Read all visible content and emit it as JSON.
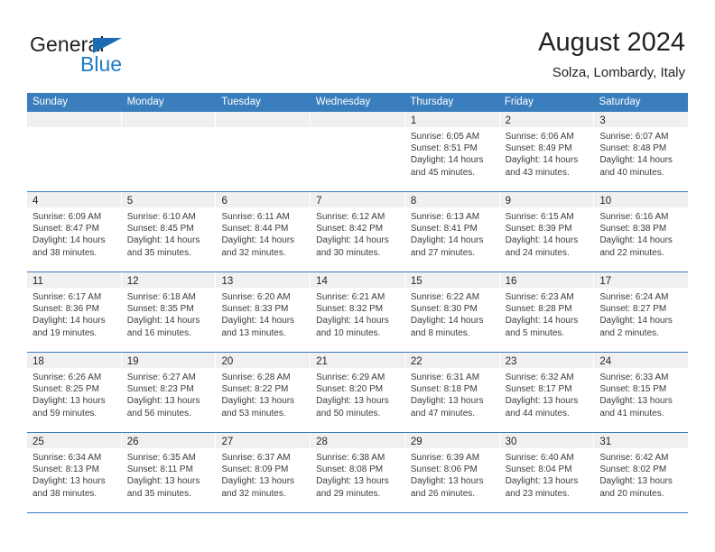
{
  "brand": {
    "word_one": "General",
    "word_two": "Blue",
    "flag_icon": "blue-triangle-flag-icon"
  },
  "header": {
    "title": "August 2024",
    "location": "Solza, Lombardy, Italy"
  },
  "colors": {
    "header_blue": "#3a7ebe",
    "brand_blue": "#1f7dc4",
    "day_band_gray": "#f0f0f0",
    "text": "#231f20"
  },
  "weekdays": [
    "Sunday",
    "Monday",
    "Tuesday",
    "Wednesday",
    "Thursday",
    "Friday",
    "Saturday"
  ],
  "labels": {
    "sunrise_prefix": "Sunrise:",
    "sunset_prefix": "Sunset:",
    "daylight_prefix": "Daylight:"
  },
  "weeks": [
    [
      {
        "day": "",
        "empty": true
      },
      {
        "day": "",
        "empty": true
      },
      {
        "day": "",
        "empty": true
      },
      {
        "day": "",
        "empty": true
      },
      {
        "day": "1",
        "sunrise": "Sunrise: 6:05 AM",
        "sunset": "Sunset: 8:51 PM",
        "daylight_line1": "Daylight: 14 hours",
        "daylight_line2": "and 45 minutes."
      },
      {
        "day": "2",
        "sunrise": "Sunrise: 6:06 AM",
        "sunset": "Sunset: 8:49 PM",
        "daylight_line1": "Daylight: 14 hours",
        "daylight_line2": "and 43 minutes."
      },
      {
        "day": "3",
        "sunrise": "Sunrise: 6:07 AM",
        "sunset": "Sunset: 8:48 PM",
        "daylight_line1": "Daylight: 14 hours",
        "daylight_line2": "and 40 minutes."
      }
    ],
    [
      {
        "day": "4",
        "sunrise": "Sunrise: 6:09 AM",
        "sunset": "Sunset: 8:47 PM",
        "daylight_line1": "Daylight: 14 hours",
        "daylight_line2": "and 38 minutes."
      },
      {
        "day": "5",
        "sunrise": "Sunrise: 6:10 AM",
        "sunset": "Sunset: 8:45 PM",
        "daylight_line1": "Daylight: 14 hours",
        "daylight_line2": "and 35 minutes."
      },
      {
        "day": "6",
        "sunrise": "Sunrise: 6:11 AM",
        "sunset": "Sunset: 8:44 PM",
        "daylight_line1": "Daylight: 14 hours",
        "daylight_line2": "and 32 minutes."
      },
      {
        "day": "7",
        "sunrise": "Sunrise: 6:12 AM",
        "sunset": "Sunset: 8:42 PM",
        "daylight_line1": "Daylight: 14 hours",
        "daylight_line2": "and 30 minutes."
      },
      {
        "day": "8",
        "sunrise": "Sunrise: 6:13 AM",
        "sunset": "Sunset: 8:41 PM",
        "daylight_line1": "Daylight: 14 hours",
        "daylight_line2": "and 27 minutes."
      },
      {
        "day": "9",
        "sunrise": "Sunrise: 6:15 AM",
        "sunset": "Sunset: 8:39 PM",
        "daylight_line1": "Daylight: 14 hours",
        "daylight_line2": "and 24 minutes."
      },
      {
        "day": "10",
        "sunrise": "Sunrise: 6:16 AM",
        "sunset": "Sunset: 8:38 PM",
        "daylight_line1": "Daylight: 14 hours",
        "daylight_line2": "and 22 minutes."
      }
    ],
    [
      {
        "day": "11",
        "sunrise": "Sunrise: 6:17 AM",
        "sunset": "Sunset: 8:36 PM",
        "daylight_line1": "Daylight: 14 hours",
        "daylight_line2": "and 19 minutes."
      },
      {
        "day": "12",
        "sunrise": "Sunrise: 6:18 AM",
        "sunset": "Sunset: 8:35 PM",
        "daylight_line1": "Daylight: 14 hours",
        "daylight_line2": "and 16 minutes."
      },
      {
        "day": "13",
        "sunrise": "Sunrise: 6:20 AM",
        "sunset": "Sunset: 8:33 PM",
        "daylight_line1": "Daylight: 14 hours",
        "daylight_line2": "and 13 minutes."
      },
      {
        "day": "14",
        "sunrise": "Sunrise: 6:21 AM",
        "sunset": "Sunset: 8:32 PM",
        "daylight_line1": "Daylight: 14 hours",
        "daylight_line2": "and 10 minutes."
      },
      {
        "day": "15",
        "sunrise": "Sunrise: 6:22 AM",
        "sunset": "Sunset: 8:30 PM",
        "daylight_line1": "Daylight: 14 hours",
        "daylight_line2": "and 8 minutes."
      },
      {
        "day": "16",
        "sunrise": "Sunrise: 6:23 AM",
        "sunset": "Sunset: 8:28 PM",
        "daylight_line1": "Daylight: 14 hours",
        "daylight_line2": "and 5 minutes."
      },
      {
        "day": "17",
        "sunrise": "Sunrise: 6:24 AM",
        "sunset": "Sunset: 8:27 PM",
        "daylight_line1": "Daylight: 14 hours",
        "daylight_line2": "and 2 minutes."
      }
    ],
    [
      {
        "day": "18",
        "sunrise": "Sunrise: 6:26 AM",
        "sunset": "Sunset: 8:25 PM",
        "daylight_line1": "Daylight: 13 hours",
        "daylight_line2": "and 59 minutes."
      },
      {
        "day": "19",
        "sunrise": "Sunrise: 6:27 AM",
        "sunset": "Sunset: 8:23 PM",
        "daylight_line1": "Daylight: 13 hours",
        "daylight_line2": "and 56 minutes."
      },
      {
        "day": "20",
        "sunrise": "Sunrise: 6:28 AM",
        "sunset": "Sunset: 8:22 PM",
        "daylight_line1": "Daylight: 13 hours",
        "daylight_line2": "and 53 minutes."
      },
      {
        "day": "21",
        "sunrise": "Sunrise: 6:29 AM",
        "sunset": "Sunset: 8:20 PM",
        "daylight_line1": "Daylight: 13 hours",
        "daylight_line2": "and 50 minutes."
      },
      {
        "day": "22",
        "sunrise": "Sunrise: 6:31 AM",
        "sunset": "Sunset: 8:18 PM",
        "daylight_line1": "Daylight: 13 hours",
        "daylight_line2": "and 47 minutes."
      },
      {
        "day": "23",
        "sunrise": "Sunrise: 6:32 AM",
        "sunset": "Sunset: 8:17 PM",
        "daylight_line1": "Daylight: 13 hours",
        "daylight_line2": "and 44 minutes."
      },
      {
        "day": "24",
        "sunrise": "Sunrise: 6:33 AM",
        "sunset": "Sunset: 8:15 PM",
        "daylight_line1": "Daylight: 13 hours",
        "daylight_line2": "and 41 minutes."
      }
    ],
    [
      {
        "day": "25",
        "sunrise": "Sunrise: 6:34 AM",
        "sunset": "Sunset: 8:13 PM",
        "daylight_line1": "Daylight: 13 hours",
        "daylight_line2": "and 38 minutes."
      },
      {
        "day": "26",
        "sunrise": "Sunrise: 6:35 AM",
        "sunset": "Sunset: 8:11 PM",
        "daylight_line1": "Daylight: 13 hours",
        "daylight_line2": "and 35 minutes."
      },
      {
        "day": "27",
        "sunrise": "Sunrise: 6:37 AM",
        "sunset": "Sunset: 8:09 PM",
        "daylight_line1": "Daylight: 13 hours",
        "daylight_line2": "and 32 minutes."
      },
      {
        "day": "28",
        "sunrise": "Sunrise: 6:38 AM",
        "sunset": "Sunset: 8:08 PM",
        "daylight_line1": "Daylight: 13 hours",
        "daylight_line2": "and 29 minutes."
      },
      {
        "day": "29",
        "sunrise": "Sunrise: 6:39 AM",
        "sunset": "Sunset: 8:06 PM",
        "daylight_line1": "Daylight: 13 hours",
        "daylight_line2": "and 26 minutes."
      },
      {
        "day": "30",
        "sunrise": "Sunrise: 6:40 AM",
        "sunset": "Sunset: 8:04 PM",
        "daylight_line1": "Daylight: 13 hours",
        "daylight_line2": "and 23 minutes."
      },
      {
        "day": "31",
        "sunrise": "Sunrise: 6:42 AM",
        "sunset": "Sunset: 8:02 PM",
        "daylight_line1": "Daylight: 13 hours",
        "daylight_line2": "and 20 minutes."
      }
    ]
  ]
}
